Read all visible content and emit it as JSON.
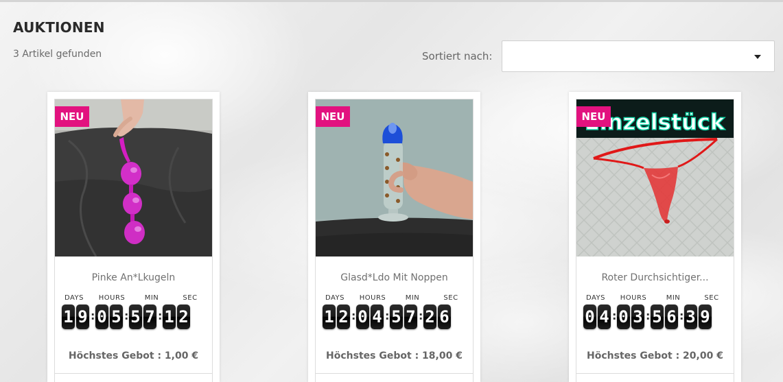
{
  "header": {
    "title": "AUKTIONEN",
    "result_count": "3 Artikel gefunden"
  },
  "sort": {
    "label": "Sortiert nach:",
    "selected": ""
  },
  "countdown_labels": {
    "days": "DAYS",
    "hours": "HOURS",
    "min": "MIN",
    "sec": "SEC"
  },
  "products": [
    {
      "badge": "NEU",
      "name": "Pinke An*Lkugeln",
      "days": [
        "1",
        "9"
      ],
      "hours": [
        "0",
        "5"
      ],
      "min": [
        "5",
        "7"
      ],
      "sec": [
        "1",
        "2"
      ],
      "bid": "Höchstes Gebot : 1,00 €"
    },
    {
      "badge": "NEU",
      "name": "Glasd*Ldo Mit Noppen",
      "days": [
        "1",
        "2"
      ],
      "hours": [
        "0",
        "4"
      ],
      "min": [
        "5",
        "7"
      ],
      "sec": [
        "2",
        "6"
      ],
      "bid": "Höchstes Gebot : 18,00 €"
    },
    {
      "badge": "NEU",
      "name": "Roter Durchsichtiger...",
      "image_text": "Einzelstück",
      "days": [
        "0",
        "4"
      ],
      "hours": [
        "0",
        "3"
      ],
      "min": [
        "5",
        "6"
      ],
      "sec": [
        "3",
        "9"
      ],
      "bid": "Höchstes Gebot : 20,00 €"
    }
  ],
  "colors": {
    "badge": "#e2127f",
    "title": "#2a2a2a",
    "muted_text": "#707070"
  }
}
